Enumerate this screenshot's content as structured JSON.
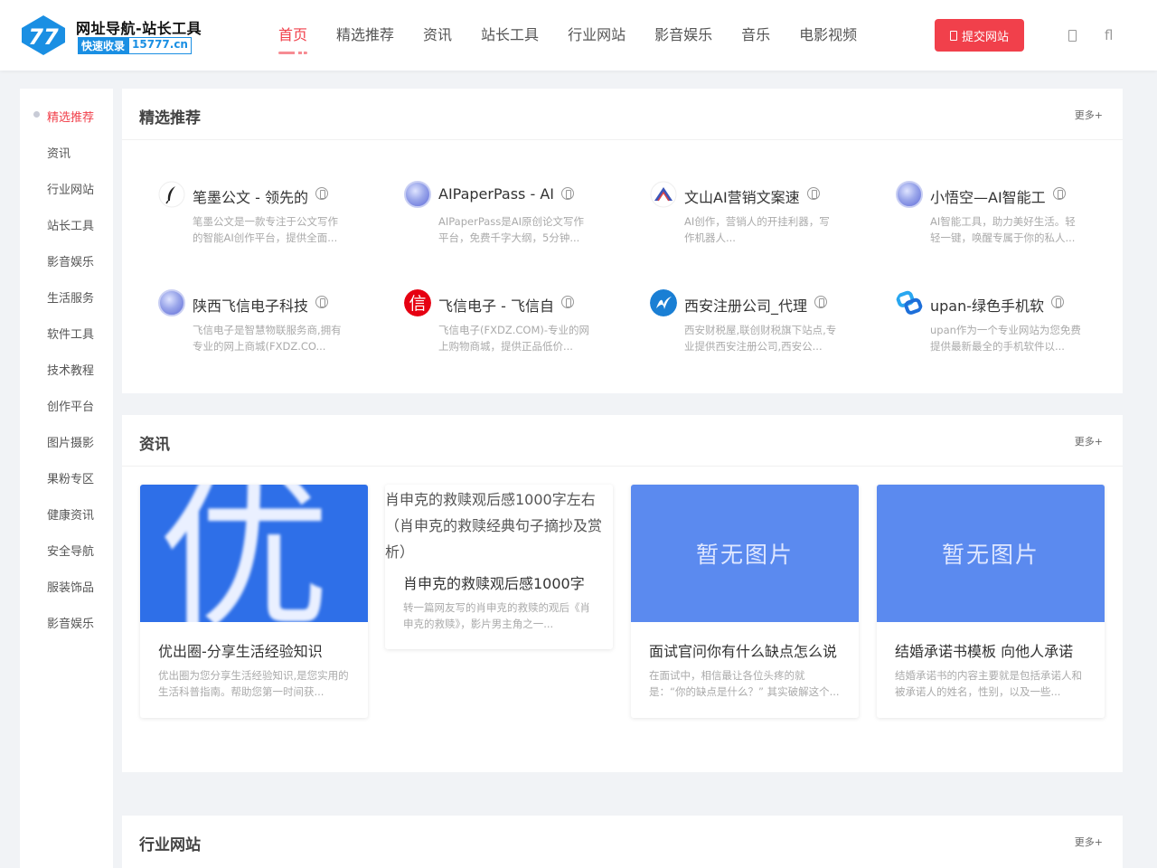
{
  "logo": {
    "title": "网址导航-站长工具",
    "sub_left": "快速收录",
    "sub_right": "15777.cn",
    "badge_text": "77"
  },
  "nav": [
    {
      "label": "首页",
      "active": true
    },
    {
      "label": "精选推荐"
    },
    {
      "label": "资讯"
    },
    {
      "label": "站长工具"
    },
    {
      "label": "行业网站"
    },
    {
      "label": "影音娱乐"
    },
    {
      "label": "音乐"
    },
    {
      "label": "电影视频"
    }
  ],
  "header": {
    "submit_label": "提交网站",
    "share_icon_glyph": "fl"
  },
  "sidebar": [
    {
      "label": "精选推荐",
      "active": true
    },
    {
      "label": "资讯"
    },
    {
      "label": "行业网站"
    },
    {
      "label": "站长工具"
    },
    {
      "label": "影音娱乐"
    },
    {
      "label": "生活服务"
    },
    {
      "label": "软件工具"
    },
    {
      "label": "技术教程"
    },
    {
      "label": "创作平台"
    },
    {
      "label": "图片摄影"
    },
    {
      "label": "果粉专区"
    },
    {
      "label": "健康资讯"
    },
    {
      "label": "安全导航"
    },
    {
      "label": "服装饰品"
    },
    {
      "label": "影音娱乐"
    }
  ],
  "featured": {
    "title": "精选推荐",
    "more": "更多+",
    "sites": [
      {
        "name": "笔墨公文 - 领先的",
        "desc": "笔墨公文是一款专注于公文写作的智能AI创作平台，提供全面...",
        "icon": "pen-nib-icon"
      },
      {
        "name": "AIPaperPass - AI",
        "desc": "AIPaperPass是AI原创论文写作平台，免费千字大纲，5分钟...",
        "icon": "globe-icon"
      },
      {
        "name": "文山AI营销文案速",
        "desc": "AI创作，营销人的开挂利器，写作机器人...",
        "icon": "mountain-icon"
      },
      {
        "name": "小悟空—AI智能工",
        "desc": "AI智能工具，助力美好生活。轻轻一键，唤醒专属于你的私人...",
        "icon": "globe-icon"
      },
      {
        "name": "陕西飞信电子科技",
        "desc": "飞信电子是智慧物联服务商,拥有专业的网上商城(FXDZ.CO...",
        "icon": "globe-icon"
      },
      {
        "name": "飞信电子 - 飞信自",
        "desc": "飞信电子(FXDZ.COM)-专业的网上购物商城，提供正品低价...",
        "icon": "xin-seal-icon",
        "icon_char": "信"
      },
      {
        "name": "西安注册公司_代理",
        "desc": "西安财税屋,联创财税旗下站点,专业提供西安注册公司,西安公...",
        "icon": "swoosh-icon"
      },
      {
        "name": "upan-绿色手机软",
        "desc": "upan作为一个专业网站为您免费提供最新最全的手机软件以...",
        "icon": "link-icon"
      }
    ]
  },
  "news": {
    "title": "资讯",
    "more": "更多+",
    "items": [
      {
        "title": "优出圈-分享生活经验知识",
        "desc": "优出圈为您分享生活经验知识,是您实用的生活科普指南。帮助您第一时间获...",
        "thumb": "image",
        "thumb_text": "优"
      },
      {
        "title": "肖申克的救赎观后感1000字",
        "desc": "转一篇网友写的肖申克的救赎的观后《肖申克的救赎》，影片男主角之一...",
        "thumb": "broken",
        "alt": "肖申克的救赎观后感1000字左右（肖申克的救赎经典句子摘抄及赏析）"
      },
      {
        "title": "面试官问你有什么缺点怎么说",
        "desc": "在面试中，相信最让各位头疼的就是：“你的缺点是什么？” 其实破解这个...",
        "thumb": "placeholder",
        "thumb_text": "暂无图片"
      },
      {
        "title": "结婚承诺书模板 向他人承诺",
        "desc": "结婚承诺书的内容主要就是包括承诺人和被承诺人的姓名，性别，以及一些...",
        "thumb": "placeholder",
        "thumb_text": "暂无图片"
      }
    ]
  },
  "industry": {
    "title": "行业网站",
    "more": "更多+"
  },
  "colors": {
    "accent": "#f1404b",
    "thumb_blue": "#5b8aef",
    "logo_blue": "#1a8fe3"
  }
}
